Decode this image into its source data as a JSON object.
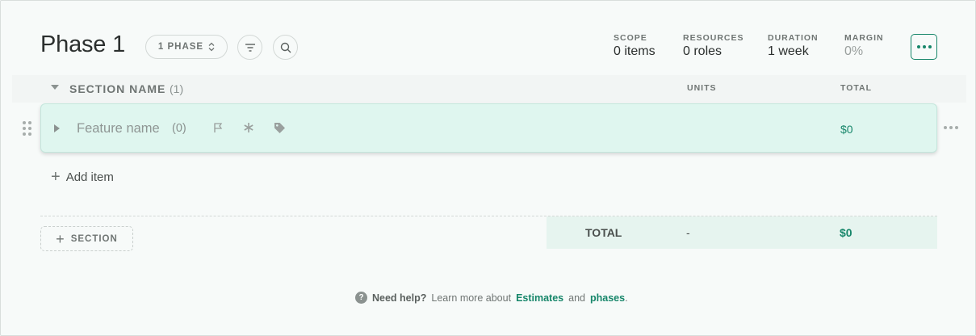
{
  "header": {
    "title": "Phase 1",
    "phase_selector": "1 PHASE",
    "stats": [
      {
        "label": "SCOPE",
        "value": "0 items"
      },
      {
        "label": "RESOURCES",
        "value": "0 roles"
      },
      {
        "label": "DURATION",
        "value": "1 week"
      },
      {
        "label": "MARGIN",
        "value": "0%"
      }
    ]
  },
  "section": {
    "name": "SECTION NAME",
    "count": "(1)",
    "columns": {
      "units": "UNITS",
      "total": "TOTAL"
    }
  },
  "feature": {
    "name": "Feature name",
    "count": "(0)",
    "total": "$0"
  },
  "add_item_label": "Add item",
  "add_section_label": "SECTION",
  "totals": {
    "label": "TOTAL",
    "units": "-",
    "value": "$0"
  },
  "help": {
    "prefix": "Need help?",
    "text": "Learn more about",
    "link1": "Estimates",
    "and": "and",
    "link2": "phases",
    "suffix": "."
  },
  "colors": {
    "accent": "#17866a",
    "feature_bg": "#dff6ef",
    "background": "#f7faf9"
  }
}
